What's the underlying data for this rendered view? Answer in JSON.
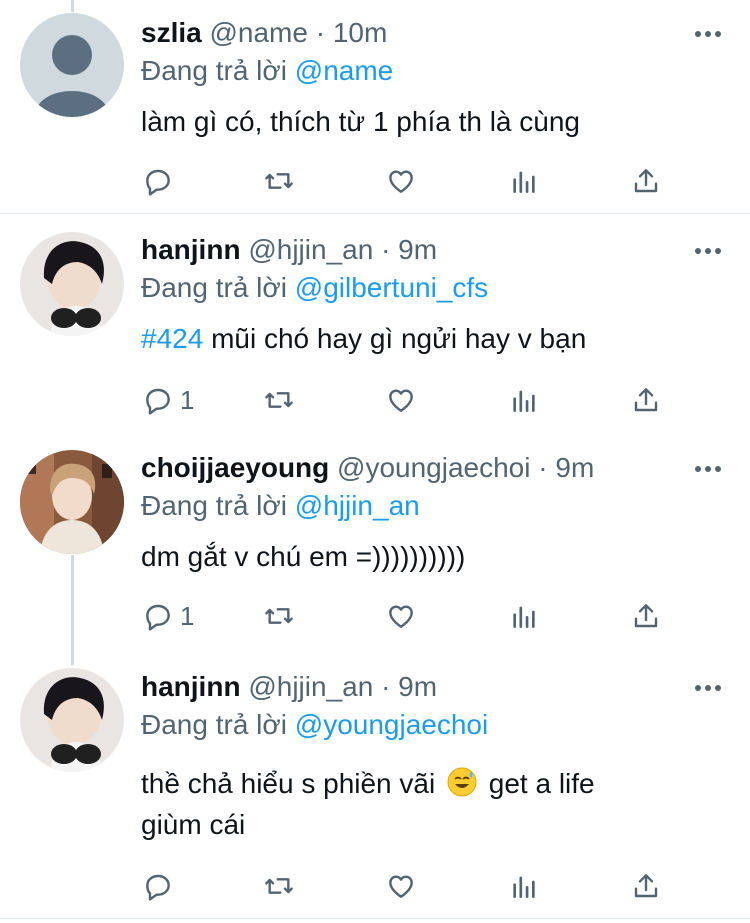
{
  "tweets": [
    {
      "name": "szlia",
      "handle": "@name",
      "dot": "·",
      "time": "10m",
      "replying_prefix": "Đang trả lời",
      "replying_to": "@name",
      "text": "làm gì có, thích từ 1 phía th là cùng",
      "reply_count": ""
    },
    {
      "name": "hanjinn",
      "handle": "@hjjin_an",
      "dot": "·",
      "time": "9m",
      "replying_prefix": "Đang trả lời",
      "replying_to": "@gilbertuni_cfs",
      "hashtag": "#424",
      "text": " mũi chó hay gì ngửi hay v bạn",
      "reply_count": "1"
    },
    {
      "name": "choijjaeyoung",
      "handle": "@youngjaechoi",
      "dot": "·",
      "time": "9m",
      "replying_prefix": "Đang trả lời",
      "replying_to": "@hjjin_an",
      "text": "dm gắt v chú em =))))))))))",
      "reply_count": "1"
    },
    {
      "name": "hanjinn",
      "handle": "@hjjin_an",
      "dot": "·",
      "time": "9m",
      "replying_prefix": "Đang trả lời",
      "replying_to": "@youngjaechoi",
      "text_part1": "thề chả hiểu s phiền vãi",
      "emoji": "sweat-smile-emoji",
      "text_part2": "get a life",
      "text_line2": "giùm cái",
      "reply_count": ""
    }
  ],
  "icons": {
    "reply": "reply-icon",
    "retweet": "retweet-icon",
    "like": "like-icon",
    "analytics": "analytics-icon",
    "share": "share-icon",
    "more": "more-icon"
  },
  "colors": {
    "link": "#1d9bf0",
    "secondary_text": "#536471",
    "thread_line": "#cfd9de"
  }
}
